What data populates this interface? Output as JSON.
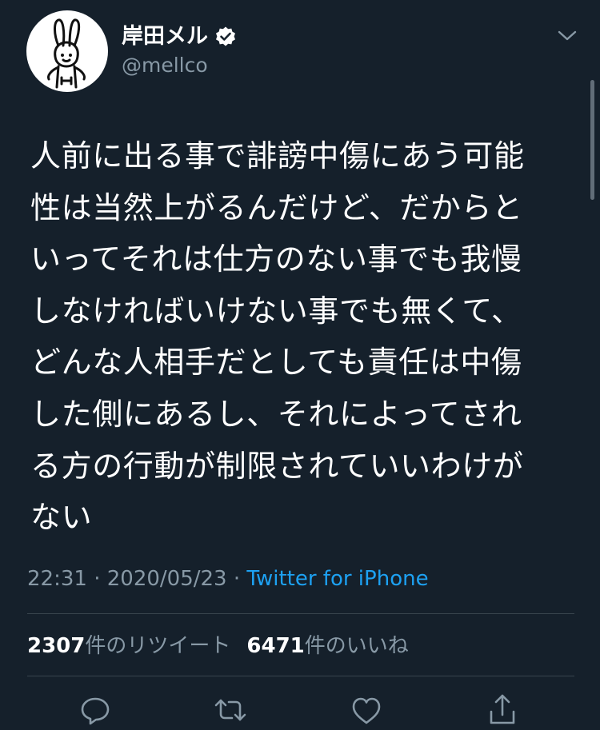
{
  "header": {
    "display_name": "岸田メル",
    "handle": "@mellco",
    "icons": {
      "avatar": "rabbit-avatar",
      "verified": "verified-badge-icon",
      "menu": "chevron-down-icon"
    }
  },
  "tweet": {
    "text": "人前に出る事で誹謗中傷にあう可能\n性は当然上がるんだけど、だからと\nいってそれは仕方のない事でも我慢\nしなければいけない事でも無くて、\nどんな人相手だとしても責任は中傷\nした側にあるし、それによってされ\nる方の行動が制限されていいわけが\nない",
    "time": "22:31",
    "separator": " · ",
    "date": "2020/05/23",
    "source": "Twitter for iPhone"
  },
  "stats": {
    "retweet_count": "2307",
    "retweet_label": "件のリツイート",
    "like_count": "6471",
    "like_label": "件のいいね"
  },
  "actions": {
    "icons": [
      "reply-icon",
      "retweet-icon",
      "like-icon",
      "share-icon"
    ]
  },
  "colors": {
    "background": "#15202b",
    "text": "#ffffff",
    "secondary": "#8899a6",
    "link": "#1da1f2",
    "divider": "#38444d"
  }
}
